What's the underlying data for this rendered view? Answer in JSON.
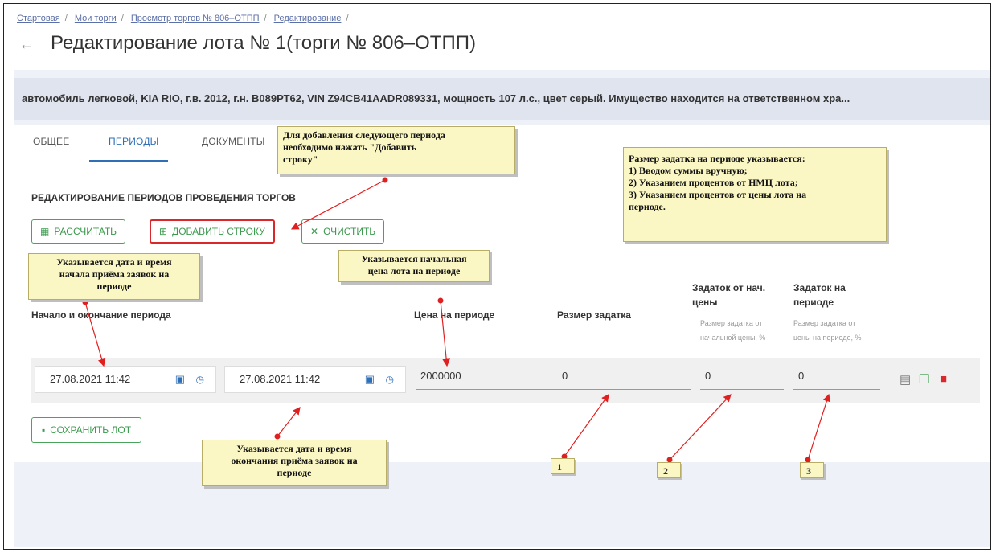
{
  "breadcrumb": [
    "Стартовая",
    "Мои торги",
    "Просмотр торгов № 806–ОТПП",
    "Редактирование"
  ],
  "page_title": "Редактирование лота № 1(торги № 806–ОТПП)",
  "description": "автомобиль легковой, KIA RIO, г.в. 2012, г.н. В089РТ62, VIN Z94CB41AADR089331, мощность 107 л.с., цвет серый. Имущество находится на ответственном хра...",
  "tabs": [
    "ОБЩЕЕ",
    "ПЕРИОДЫ",
    "ДОКУМЕНТЫ"
  ],
  "active_tab": "ПЕРИОДЫ",
  "section_title": "РЕДАКТИРОВАНИЕ ПЕРИОДОВ ПРОВЕДЕНИЯ ТОРГОВ",
  "buttons": {
    "calc": "РАССЧИТАТЬ",
    "add_row": "ДОБАВИТЬ СТРОКУ",
    "clear": "ОЧИСТИТЬ",
    "save": "СОХРАНИТЬ ЛОТ"
  },
  "columns": {
    "period": "Начало и окончание периода",
    "price": "Цена на периоде",
    "deposit": "Размер задатка",
    "deposit_start_a": "Задаток от нач.",
    "deposit_start_b": "цены",
    "deposit_start_sub_a": "Размер задатка от",
    "deposit_start_sub_b": "начальной цены, %",
    "deposit_period_a": "Задаток на",
    "deposit_period_b": "периоде",
    "deposit_period_sub_a": "Размер задатка от",
    "deposit_period_sub_b": "цены на периоде, %"
  },
  "row": {
    "start": "27.08.2021 11:42",
    "end": "27.08.2021 11:42",
    "price": "2000000",
    "deposit": "0",
    "deposit_start_pct": "0",
    "deposit_period_pct": "0"
  },
  "notes": {
    "add_row_a": "Для добавления следующего периода",
    "add_row_b": "необходимо нажать \"Добавить",
    "add_row_c": "строку\"",
    "deposit_a": "Размер задатка на периоде указывается:",
    "deposit_b": "1) Вводом суммы вручную;",
    "deposit_c": "2) Указанием процентов от НМЦ лота;",
    "deposit_d": "3) Указанием процентов от цены лота на",
    "deposit_e": "периоде.",
    "start_a": "Указывается дата и время",
    "start_b": "начала приёма заявок на",
    "start_c": "периоде",
    "price_a": "Указывается начальная",
    "price_b": "цена лота на периоде",
    "end_a": "Указывается дата и время",
    "end_b": "окончания приёма заявок на",
    "end_c": "периоде"
  },
  "markers": [
    "1",
    "2",
    "3"
  ],
  "icons": {
    "back": "arrow-left-icon",
    "calendar": "calendar-icon",
    "clock": "clock-icon",
    "comment": "comment-icon",
    "copy": "copy-icon",
    "delete": "trash-icon"
  },
  "colors": {
    "accent": "#2f6fb6",
    "green": "#3b9a4d",
    "red": "#d8282b",
    "note_bg": "#fbf7c4"
  }
}
